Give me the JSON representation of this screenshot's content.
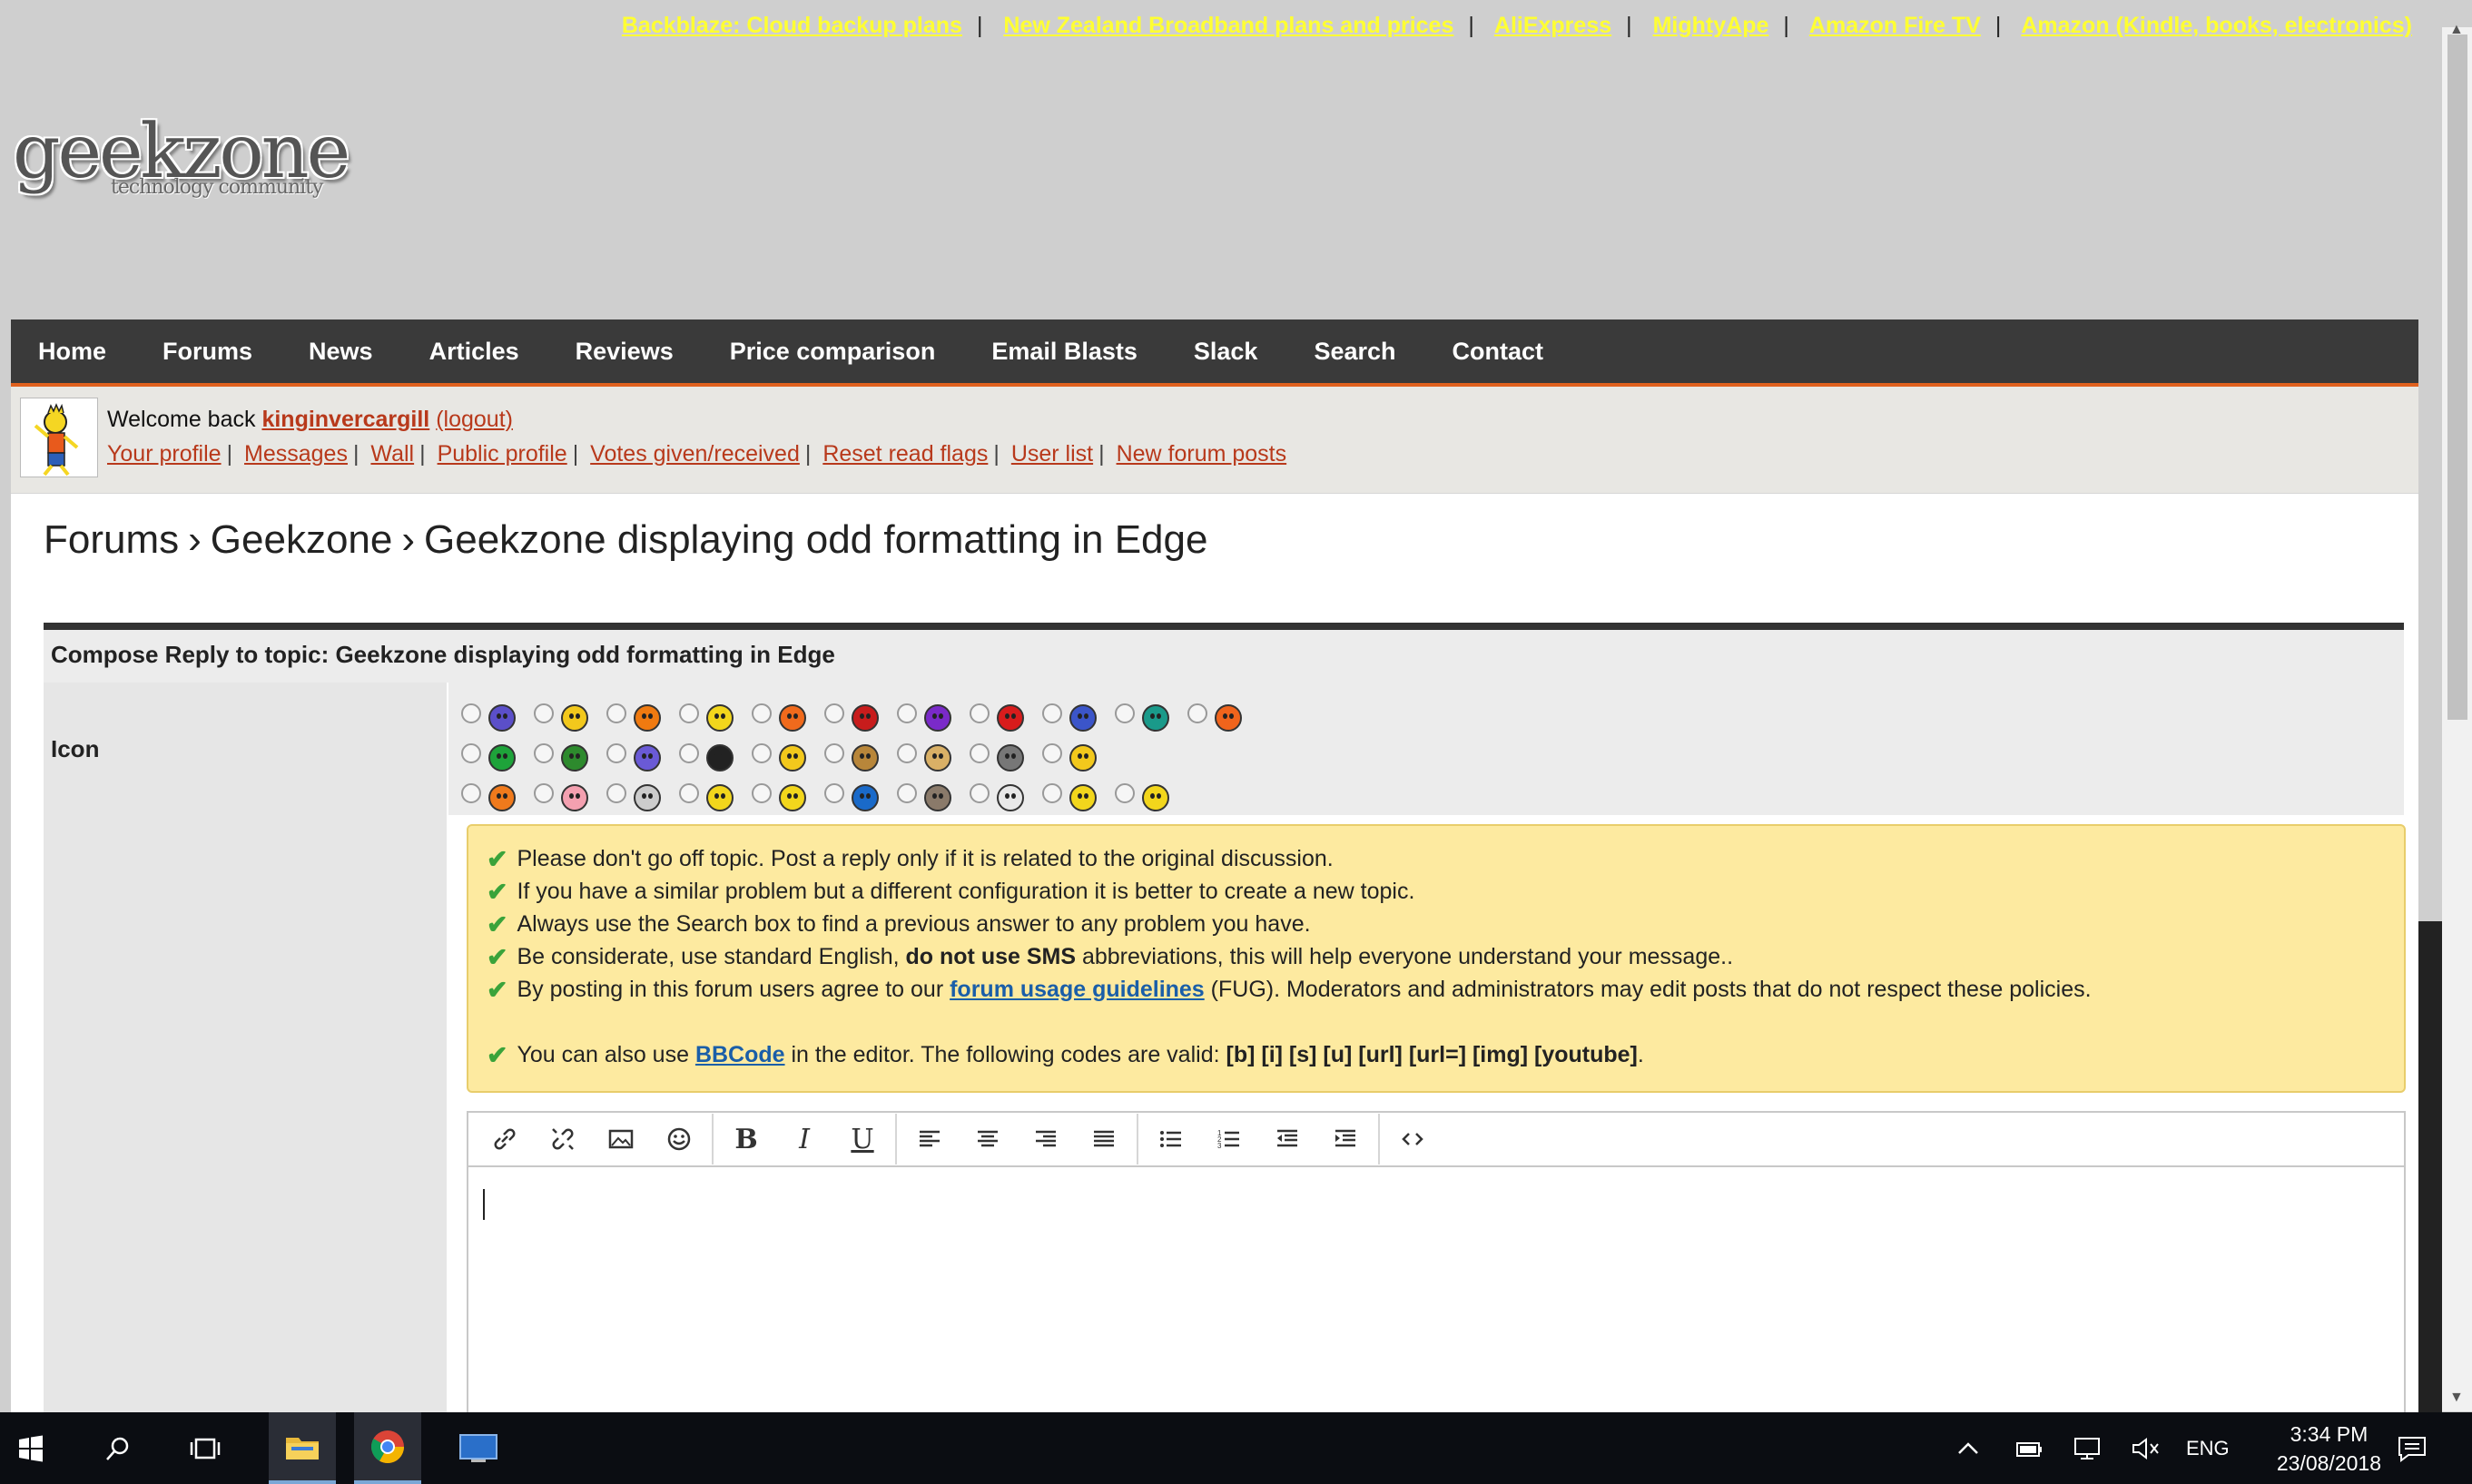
{
  "top_links": [
    "Backblaze: Cloud backup plans",
    "New Zealand Broadband plans and prices",
    "AliExpress",
    "MightyApe",
    "Amazon Fire TV",
    "Amazon (Kindle, books, electronics)"
  ],
  "logo": {
    "word": "geekzone",
    "tagline": "technology community"
  },
  "nav": [
    "Home",
    "Forums",
    "News",
    "Articles",
    "Reviews",
    "Price comparison",
    "Email Blasts",
    "Slack",
    "Search",
    "Contact"
  ],
  "user": {
    "welcome": "Welcome back",
    "username": "kinginvercargill",
    "logout": "(logout)",
    "links": [
      "Your profile",
      "Messages",
      "Wall",
      "Public profile",
      "Votes given/received",
      "Reset read flags",
      "User list",
      "New forum posts"
    ]
  },
  "breadcrumb": {
    "sep": "›",
    "items": [
      "Forums",
      "Geekzone",
      "Geekzone displaying odd formatting in Edge"
    ]
  },
  "compose": {
    "header": "Compose Reply to topic: Geekzone displaying odd formatting in Edge",
    "icon_label": "Icon",
    "icon_colors": [
      [
        "#5b4fc9",
        "#f2c81c",
        "#f07a10",
        "#f2d61c",
        "#f06a1c",
        "#c81c1c",
        "#7a2ac9",
        "#d81c1c",
        "#3b55c9",
        "#1a9a8a",
        "#f0641c"
      ],
      [
        "#1ea33a",
        "#2d8a2d",
        "#6a5ad6",
        "#222222",
        "#f2c81c",
        "#b8863a",
        "#d9b066",
        "#777777",
        "#f2c81c"
      ],
      [
        "#f07a1c",
        "#f4a0b0",
        "#cccccc",
        "#f2d61c",
        "#f2d61c",
        "#1a6ac9",
        "#8a7a6a",
        "#e8e8e8",
        "#f2d61c",
        "#f2d61c"
      ]
    ],
    "rules": {
      "r1": "Please don't go off topic. Post a reply only if it is related to the original discussion.",
      "r2": "If you have a similar problem but a different configuration it is better to create a new topic.",
      "r3": "Always use the Search box to find a previous answer to any problem you have.",
      "r4_a": "Be considerate, use standard English,",
      "r4_b": "do not use SMS",
      "r4_c": "abbreviations, this will help everyone understand your message..",
      "r5_a": "By posting in this forum users agree to our",
      "r5_link": "forum usage guidelines",
      "r5_b": "(FUG). Moderators and administrators may edit posts that do not respect these policies.",
      "r6_a": "You can also use",
      "r6_link": "BBCode",
      "r6_b": "in the editor. The following codes are valid:",
      "r6_codes": "[b] [i] [s] [u] [url] [url=] [img] [youtube]",
      "r6_c": "."
    },
    "toolbar": {
      "bold": "B",
      "italic": "I",
      "underline": "U"
    }
  },
  "taskbar": {
    "time": "3:34 PM",
    "date": "23/08/2018",
    "lang": "ENG"
  }
}
